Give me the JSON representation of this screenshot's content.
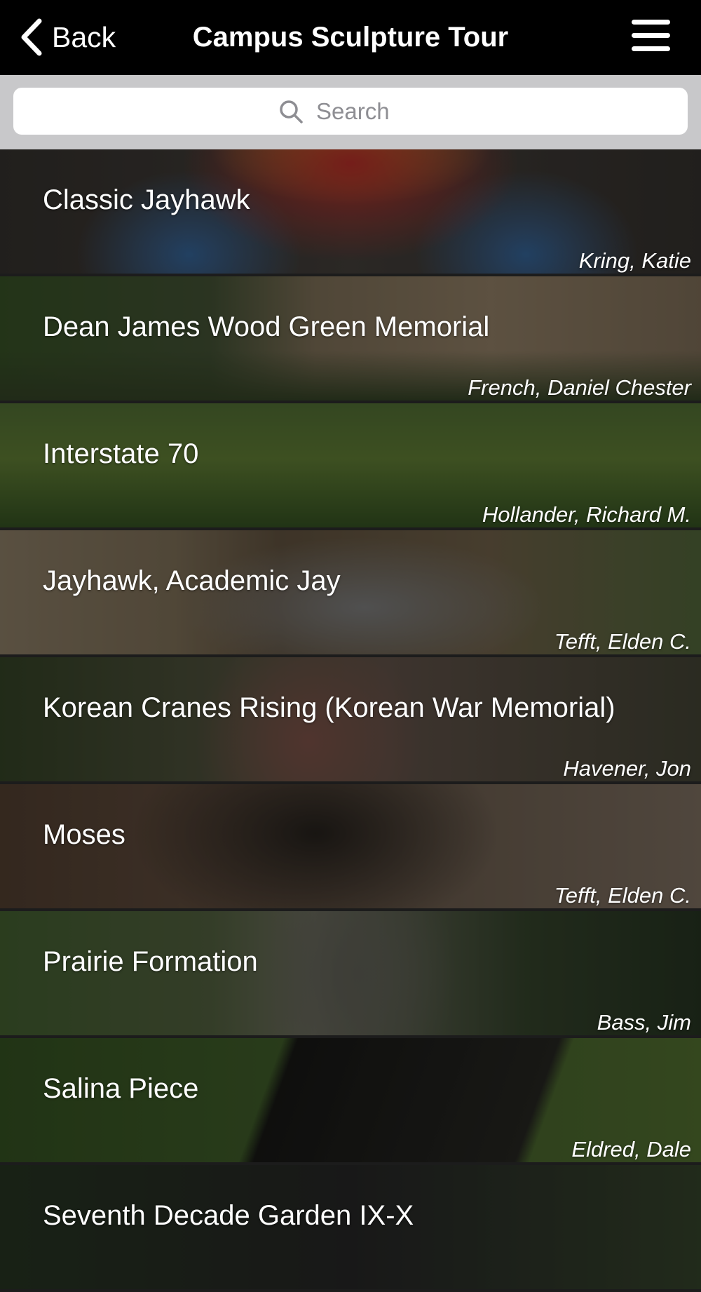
{
  "header": {
    "back_label": "Back",
    "title": "Campus Sculpture Tour",
    "back_icon": "chevron-left-icon",
    "menu_icon": "hamburger-menu-icon"
  },
  "search": {
    "placeholder": "Search",
    "value": "",
    "icon": "search-icon"
  },
  "sculptures": [
    {
      "title": "Classic Jayhawk",
      "artist": "Kring, Katie"
    },
    {
      "title": "Dean James Wood Green Memorial",
      "artist": "French, Daniel Chester"
    },
    {
      "title": "Interstate 70",
      "artist": "Hollander, Richard M."
    },
    {
      "title": "Jayhawk, Academic Jay",
      "artist": "Tefft, Elden C."
    },
    {
      "title": "Korean Cranes Rising (Korean War Memorial)",
      "artist": "Havener, Jon"
    },
    {
      "title": "Moses",
      "artist": "Tefft, Elden C."
    },
    {
      "title": "Prairie Formation",
      "artist": "Bass, Jim"
    },
    {
      "title": "Salina Piece",
      "artist": "Eldred, Dale"
    },
    {
      "title": "Seventh Decade Garden IX-X",
      "artist": ""
    }
  ],
  "colors": {
    "navbar": "#000000",
    "search_bar_bg": "#c8c8ca",
    "row_text": "#ffffff"
  }
}
